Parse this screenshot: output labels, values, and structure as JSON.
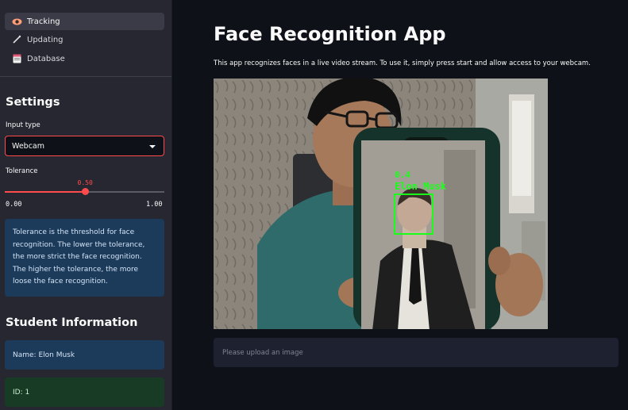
{
  "sidebar": {
    "nav": [
      {
        "label": "Tracking",
        "icon": "eye-icon",
        "active": true
      },
      {
        "label": "Updating",
        "icon": "pencil-icon",
        "active": false
      },
      {
        "label": "Database",
        "icon": "database-icon",
        "active": false
      }
    ],
    "settings_heading": "Settings",
    "input_type_label": "Input type",
    "input_type_value": "Webcam",
    "tolerance_label": "Tolerance",
    "tolerance": {
      "value": "0.50",
      "min": "0.00",
      "max": "1.00",
      "fraction": 0.5
    },
    "tolerance_info": "Tolerance is the threshold for face recognition. The lower the tolerance, the more strict the face recognition. The higher the tolerance, the more loose the face recognition.",
    "student_heading": "Student Information",
    "student_name": "Name: Elon Musk",
    "student_id": "ID: 1"
  },
  "main": {
    "title": "Face Recognition App",
    "description": "This app recognizes faces in a live video stream. To use it, simply press start and allow access to your webcam.",
    "detection": {
      "score": "0.4",
      "name": "Elon Musk"
    },
    "upload_placeholder": "Please upload an image"
  },
  "colors": {
    "accent": "#ff4b4b",
    "detection_box": "#1aff1a",
    "info_bg": "#1c3a5a",
    "success_bg": "#173b24"
  }
}
